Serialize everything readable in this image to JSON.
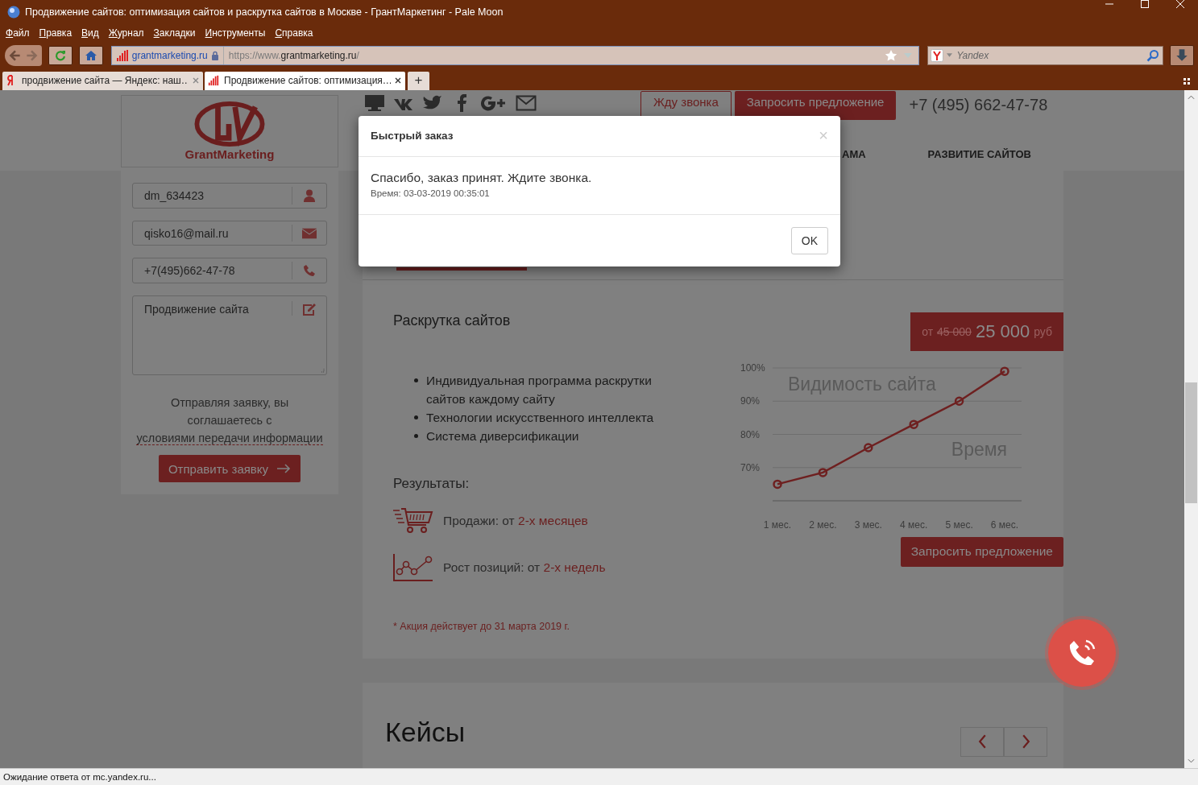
{
  "window": {
    "title": "Продвижение сайтов: оптимизация сайтов и раскрутка сайтов в Москве - ГрантМаркетинг - Pale Moon"
  },
  "menu": [
    "Файл",
    "Правка",
    "Вид",
    "Журнал",
    "Закладки",
    "Инструменты",
    "Справка"
  ],
  "toolbar": {
    "identity": "grantmarketing.ru",
    "url_scheme": "https://www.",
    "url_host": "grantmarketing.ru",
    "url_path": "/",
    "search_placeholder": "Yandex"
  },
  "tabs": [
    {
      "title": "продвижение сайта — Яндекс: наш…",
      "kind": "search",
      "selected": false
    },
    {
      "title": "Продвижение сайтов: оптимизация…",
      "kind": "site",
      "selected": true
    }
  ],
  "new_tab": "+",
  "site": {
    "header": {
      "logo_text": "GrantMarketing",
      "buttons": [
        {
          "label": "Жду звонка",
          "kind": "outline"
        },
        {
          "label": "Запросить предложение",
          "kind": "filled"
        }
      ],
      "phone": "+7 (495) 662-47-78",
      "nav": [
        "АМА",
        "РАЗВИТИЕ САЙТОВ"
      ]
    },
    "form": {
      "fields": [
        {
          "value": "dm_634423",
          "kind": "user"
        },
        {
          "value": "qisko16@mail.ru",
          "kind": "email"
        },
        {
          "value": "+7(495)662-47-78",
          "kind": "phone"
        },
        {
          "value": "Продвижение сайта",
          "kind": "message"
        }
      ],
      "consent_text": "Отправляя заявку, вы соглашаетесь с",
      "consent_link": "условиями передачи информации",
      "submit": "Отправить заявку"
    },
    "offer": {
      "title": "Раскрутка сайтов",
      "features": [
        "Индивидуальная программа раскрутки сайтов каждому сайту",
        "Технологии искусственного интеллекта",
        "Система диверсификации"
      ],
      "price": {
        "prefix": "от",
        "old": "45 000",
        "new": "25 000",
        "currency": "руб"
      },
      "chart_data": {
        "type": "line",
        "title": "Видимость сайта",
        "xlabel": "Время",
        "categories": [
          "1 мес.",
          "2 мес.",
          "3 мес.",
          "4 мес.",
          "5 мес.",
          "6 мес."
        ],
        "series": [
          {
            "color": "#6e2020",
            "marker": "circle",
            "values": [
              65,
              68.5,
              76,
              83,
              90,
              99
            ]
          }
        ],
        "grid": true,
        "ylim": [
          60,
          100
        ],
        "yticks": [
          {
            "value": 70,
            "label": "70%"
          },
          {
            "value": 80,
            "label": "80%"
          },
          {
            "value": 90,
            "label": "90%"
          },
          {
            "value": 100,
            "label": "100%"
          }
        ]
      },
      "cta": "Запросить предложение",
      "results_title": "Результаты:",
      "results": [
        {
          "kind": "sales",
          "label": "Продажи: от",
          "highlight": "2-х месяцев"
        },
        {
          "kind": "positions",
          "label": "Рост позиций: от",
          "highlight": "2-х недель"
        }
      ],
      "note": "* Акция действует до 31 марта 2019 г."
    },
    "cases": {
      "title": "Кейсы"
    }
  },
  "modal": {
    "title": "Быстрый заказ",
    "close": "×",
    "message": "Спасибо, заказ принят. Ждите звонка.",
    "time_label": "Время:",
    "time": "03-03-2019 00:35:01",
    "ok": "OK"
  },
  "status_bar": "Ожидание ответа от mc.yandex.ru..."
}
